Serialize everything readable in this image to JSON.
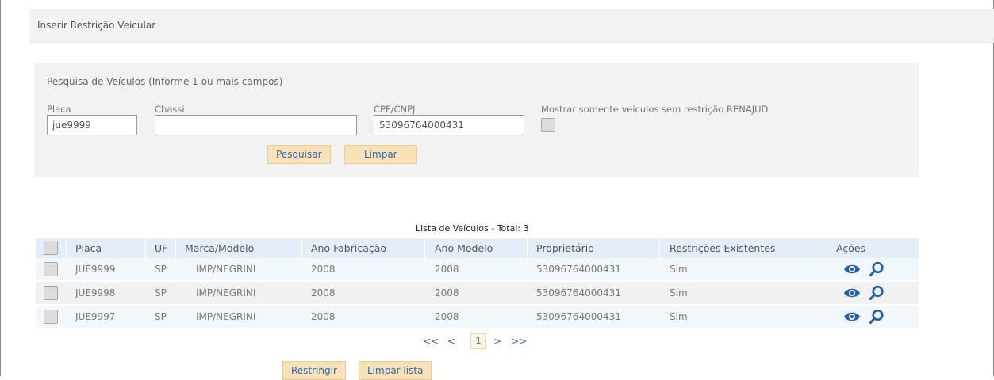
{
  "page": {
    "title": "Inserir Restrição Veicular"
  },
  "search": {
    "panel_title": "Pesquisa de Veículos (Informe 1 ou mais campos)",
    "placa_label": "Placa",
    "placa_value": "jue9999",
    "chassi_label": "Chassi",
    "chassi_value": "",
    "cpf_label": "CPF/CNPJ",
    "cpf_value": "53096764000431",
    "checkbox_label": "Mostrar somente veículos sem restrição RENAJUD",
    "checkbox_checked": false,
    "search_button": "Pesquisar",
    "clear_button": "Limpar"
  },
  "list": {
    "caption": "Lista de Veículos - Total: 3",
    "columns": [
      "Placa",
      "UF",
      "Marca/Modelo",
      "Ano Fabricação",
      "Ano Modelo",
      "Proprietário",
      "Restrições Existentes",
      "Ações"
    ],
    "rows": [
      {
        "placa": "JUE9999",
        "uf": "SP",
        "marca": "IMP/NEGRINI",
        "ano_fab": "2008",
        "ano_mod": "2008",
        "proprietario": "53096764000431",
        "restricoes": "Sim"
      },
      {
        "placa": "JUE9998",
        "uf": "SP",
        "marca": "IMP/NEGRINI",
        "ano_fab": "2008",
        "ano_mod": "2008",
        "proprietario": "53096764000431",
        "restricoes": "Sim"
      },
      {
        "placa": "JUE9997",
        "uf": "SP",
        "marca": "IMP/NEGRINI",
        "ano_fab": "2008",
        "ano_mod": "2008",
        "proprietario": "53096764000431",
        "restricoes": "Sim"
      }
    ],
    "action_icons": [
      "eye-icon",
      "search-icon"
    ]
  },
  "pagination": {
    "first": "<<",
    "prev": "<",
    "current": "1",
    "next": ">",
    "last": ">>"
  },
  "footer": {
    "restrict_button": "Restringir",
    "clear_list_button": "Limpar lista"
  },
  "colors": {
    "accent_blue": "#2f67b8",
    "button_bg": "#f7e1b5",
    "header_bg": "#e3eef8",
    "icon_blue": "#1f5fae"
  }
}
